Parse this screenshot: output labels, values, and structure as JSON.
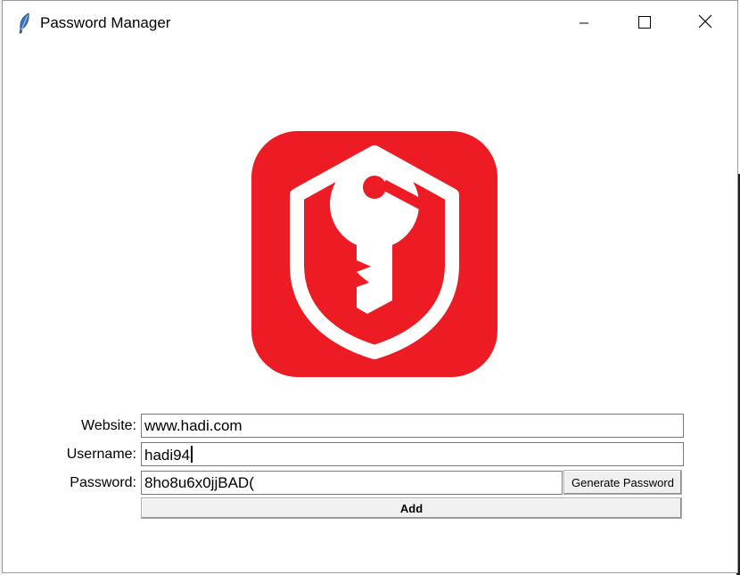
{
  "window": {
    "title": "Password Manager",
    "controls": {
      "minimize": "minimize",
      "maximize": "maximize",
      "close": "close"
    }
  },
  "logo": {
    "name": "shield-key-logo",
    "background_color": "#ed1c24",
    "foreground_color": "#ffffff"
  },
  "form": {
    "website_label": "Website:",
    "website_value": "www.hadi.com",
    "username_label": "Username:",
    "username_value": "hadi94",
    "password_label": "Password:",
    "password_value": "8ho8u6x0jjBAD(",
    "generate_button": "Generate Password",
    "add_button": "Add"
  },
  "icons": {
    "app": "feather-icon",
    "minimize": "minimize-icon",
    "maximize": "maximize-icon",
    "close": "close-icon"
  }
}
